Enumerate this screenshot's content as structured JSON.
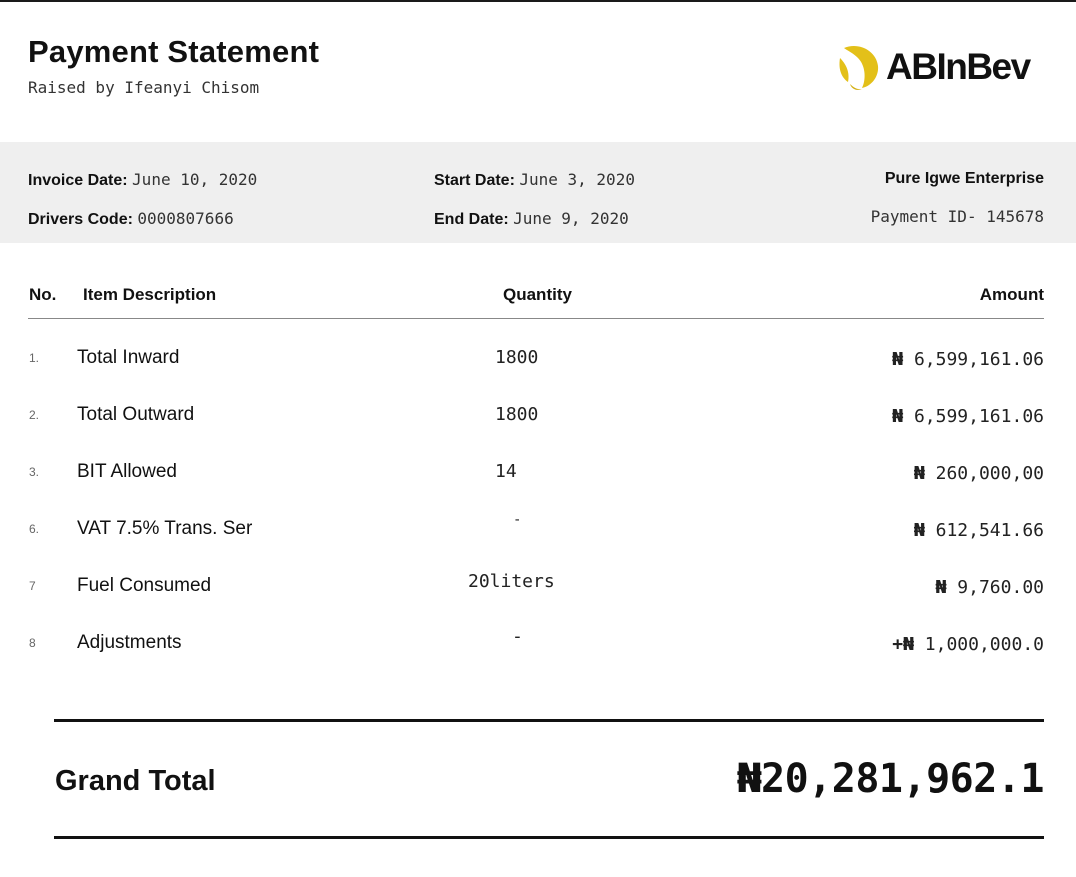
{
  "header": {
    "title": "Payment Statement",
    "subtitle": "Raised by Ifeanyi Chisom",
    "logo_text": "ABInBev",
    "logo_color": "#e3c019"
  },
  "info": {
    "invoice_date_label": "Invoice Date:",
    "invoice_date": "June 10, 2020",
    "drivers_code_label": "Drivers Code:",
    "drivers_code": "0000807666",
    "start_date_label": "Start Date:",
    "start_date": "June 3, 2020",
    "end_date_label": "End Date:",
    "end_date": "June 9, 2020",
    "company": "Pure Igwe Enterprise",
    "payment_id": "Payment ID- 145678"
  },
  "table": {
    "headers": {
      "no": "No.",
      "description": "Item Description",
      "quantity": "Quantity",
      "amount": "Amount"
    },
    "rows": [
      {
        "no": "1.",
        "description": "Total Inward",
        "quantity": "1800",
        "currency": "₦",
        "amount": "6,599,161.06"
      },
      {
        "no": "2.",
        "description": "Total Outward",
        "quantity": "1800",
        "currency": "₦",
        "amount": "6,599,161.06"
      },
      {
        "no": "3.",
        "description": "BIT Allowed",
        "quantity": "14",
        "currency": "₦",
        "amount": "260,000,00"
      },
      {
        "no": "6.",
        "description": "VAT 7.5% Trans. Ser",
        "quantity": "-",
        "currency": "₦",
        "amount": "612,541.66"
      },
      {
        "no": "7",
        "description": "Fuel Consumed",
        "quantity": "20liters",
        "currency": "₦",
        "amount": "9,760.00"
      },
      {
        "no": "8",
        "description": "Adjustments",
        "quantity": "-",
        "currency": "+₦",
        "amount": "1,000,000.0"
      }
    ]
  },
  "total": {
    "label": "Grand Total",
    "value": "₦20,281,962.1"
  }
}
